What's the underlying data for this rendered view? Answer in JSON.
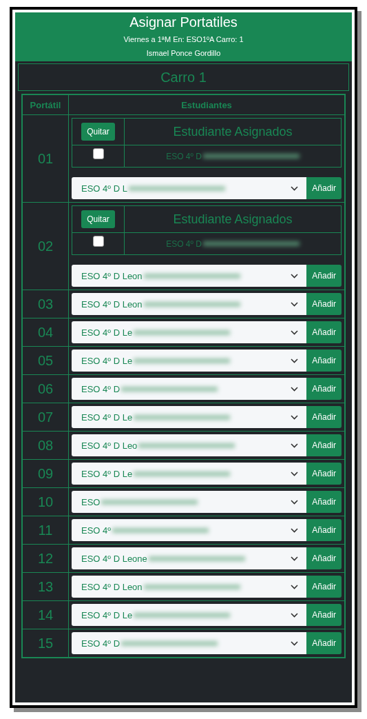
{
  "header": {
    "title": "Asignar Portatiles",
    "subtitle": "Viernes a 1ªM En: ESO1ºA Carro: 1",
    "teacher": "Ismael Ponce Gordillo"
  },
  "cart": {
    "title": "Carro 1",
    "columns": [
      "Portátil",
      "Estudiantes"
    ],
    "laptops": [
      {
        "number": "01",
        "assigned": {
          "heading": "Estudiante Asignados",
          "remove_button": "Quitar",
          "students": [
            {
              "name": "ESO 4º D",
              "checked": false
            }
          ]
        },
        "select": "ESO 4º D L",
        "add_button": "Añadir"
      },
      {
        "number": "02",
        "assigned": {
          "heading": "Estudiante Asignados",
          "remove_button": "Quitar",
          "students": [
            {
              "name": "ESO 4º D",
              "checked": false
            }
          ]
        },
        "select": "ESO 4º D Leon",
        "add_button": "Añadir"
      },
      {
        "number": "03",
        "select": "ESO 4º D Leon",
        "add_button": "Añadir"
      },
      {
        "number": "04",
        "select": "ESO 4º D Le",
        "add_button": "Añadir"
      },
      {
        "number": "05",
        "select": "ESO 4º D Le",
        "add_button": "Añadir"
      },
      {
        "number": "06",
        "select": "ESO 4º D",
        "add_button": "Añadir"
      },
      {
        "number": "07",
        "select": "ESO 4º D Le",
        "add_button": "Añadir"
      },
      {
        "number": "08",
        "select": "ESO 4º D Leo",
        "add_button": "Añadir"
      },
      {
        "number": "09",
        "select": "ESO 4º D Le",
        "add_button": "Añadir"
      },
      {
        "number": "10",
        "select": "ESO",
        "add_button": "Añadir"
      },
      {
        "number": "11",
        "select": "ESO 4º",
        "add_button": "Añadir"
      },
      {
        "number": "12",
        "select": "ESO 4º D Leone",
        "add_button": "Añadir"
      },
      {
        "number": "13",
        "select": "ESO 4º D Leon",
        "add_button": "Añadir"
      },
      {
        "number": "14",
        "select": "ESO 4º D Le",
        "add_button": "Añadir"
      },
      {
        "number": "15",
        "select": "ESO 4º D",
        "add_button": "Añadir"
      }
    ]
  }
}
